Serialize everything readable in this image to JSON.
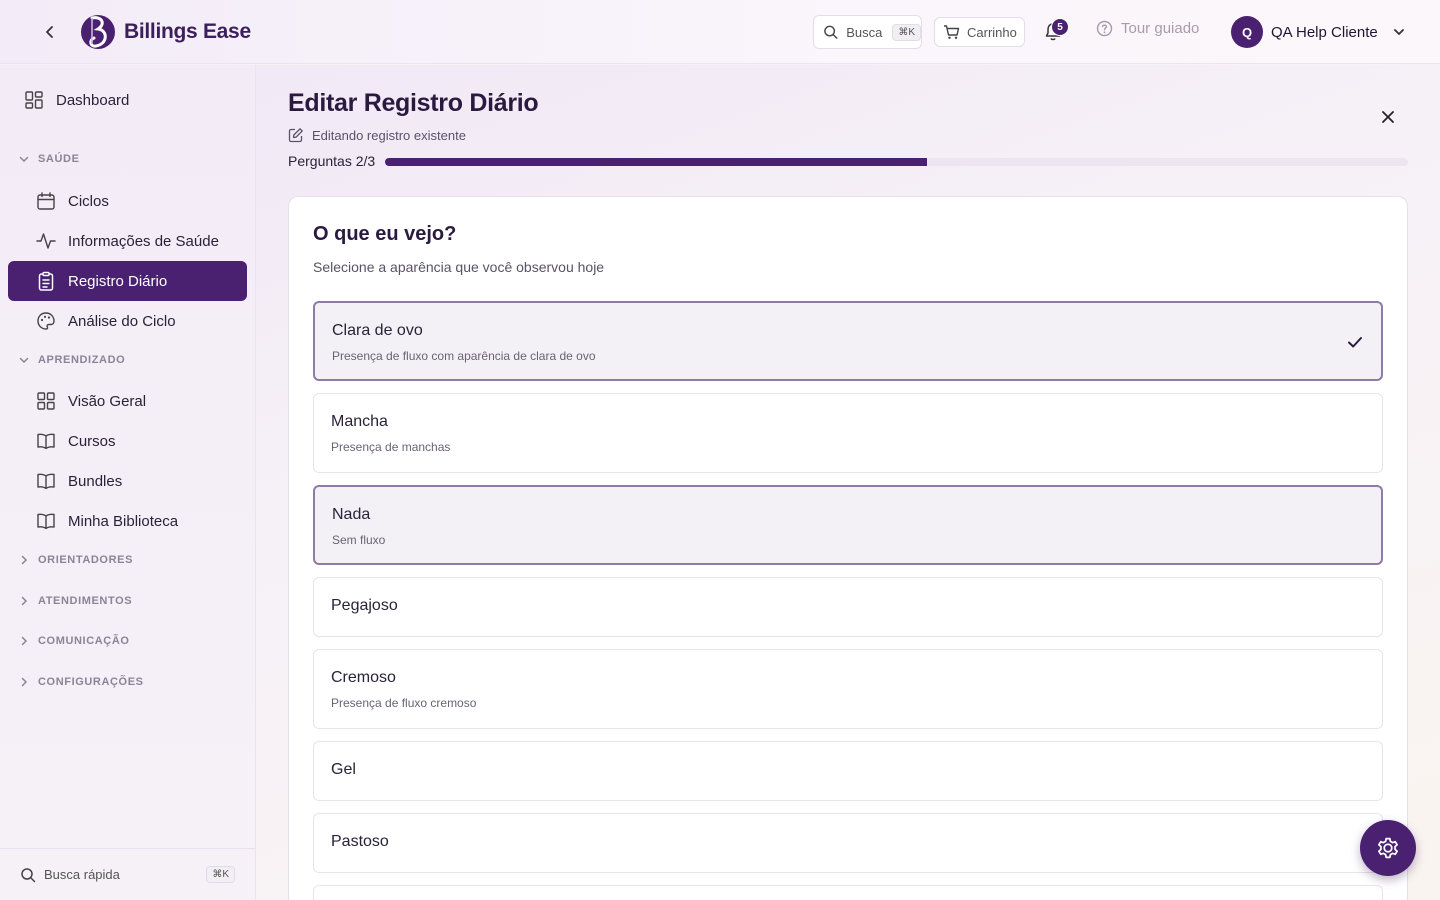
{
  "header": {
    "brand": "Billings Ease",
    "search_label": "Busca",
    "search_shortcut": "⌘K",
    "cart_label": "Carrinho",
    "notifications_count": "5",
    "tour_label": "Tour guiado",
    "user_initial": "Q",
    "user_name": "QA Help Cliente"
  },
  "sidebar": {
    "dashboard": "Dashboard",
    "sections": {
      "saude": "SAÚDE",
      "aprendizado": "APRENDIZADO",
      "orientadores": "ORIENTADORES",
      "atendimentos": "ATENDIMENTOS",
      "comunicacao": "COMUNICAÇÃO",
      "configuracoes": "CONFIGURAÇÕES"
    },
    "saude_items": [
      "Ciclos",
      "Informações de Saúde",
      "Registro Diário",
      "Análise do Ciclo"
    ],
    "aprendizado_items": [
      "Visão Geral",
      "Cursos",
      "Bundles",
      "Minha Biblioteca"
    ],
    "quick_search": "Busca rápida",
    "quick_search_shortcut": "⌘K"
  },
  "main": {
    "title": "Editar Registro Diário",
    "subtitle": "Editando registro existente",
    "progress_label": "Perguntas 2/3",
    "progress_fraction": 0.53,
    "question": {
      "title": "O que eu vejo?",
      "description": "Selecione a aparência que você observou hoje",
      "options": [
        {
          "label": "Clara de ovo",
          "desc": "Presença de fluxo com aparência de clara de ovo",
          "selected": true
        },
        {
          "label": "Mancha",
          "desc": "Presença de manchas",
          "selected": false
        },
        {
          "label": "Nada",
          "desc": "Sem fluxo",
          "selected": true
        },
        {
          "label": "Pegajoso",
          "desc": "",
          "selected": false
        },
        {
          "label": "Cremoso",
          "desc": "Presença de fluxo cremoso",
          "selected": false
        },
        {
          "label": "Gel",
          "desc": "",
          "selected": false
        },
        {
          "label": "Pastoso",
          "desc": "",
          "selected": false
        }
      ]
    }
  },
  "colors": {
    "accent": "#4a2070",
    "selected_border": "#8f7aa8",
    "selected_bg": "#f4f1f6"
  }
}
